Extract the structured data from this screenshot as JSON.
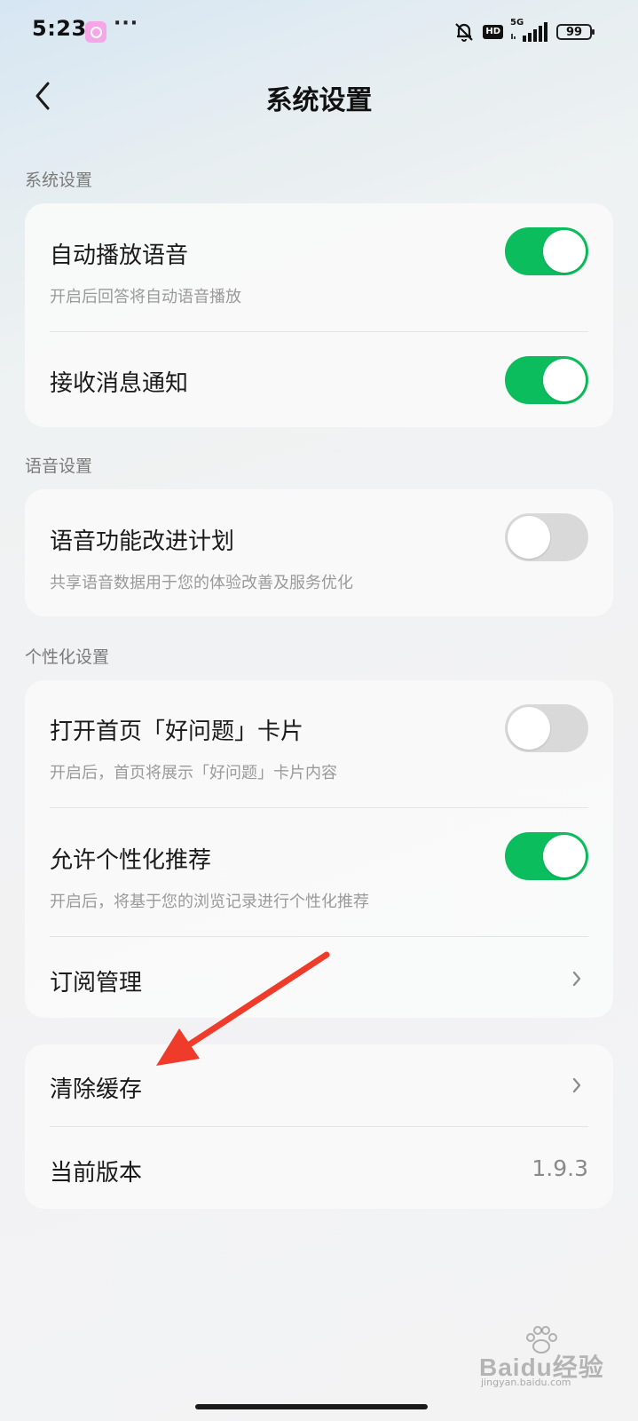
{
  "status_bar": {
    "time": "5:23",
    "more": "···",
    "hd": "HD",
    "network": "5G",
    "battery": "99"
  },
  "header": {
    "title": "系统设置"
  },
  "sections": {
    "system": {
      "label": "系统设置",
      "items": [
        {
          "title": "自动播放语音",
          "desc": "开启后回答将自动语音播放",
          "toggle": true
        },
        {
          "title": "接收消息通知",
          "toggle": true
        }
      ]
    },
    "voice": {
      "label": "语音设置",
      "items": [
        {
          "title": "语音功能改进计划",
          "desc": "共享语音数据用于您的体验改善及服务优化",
          "toggle": false
        }
      ]
    },
    "personal": {
      "label": "个性化设置",
      "items": [
        {
          "title": "打开首页「好问题」卡片",
          "desc": "开启后，首页将展示「好问题」卡片内容",
          "toggle": false
        },
        {
          "title": "允许个性化推荐",
          "desc": "开启后，将基于您的浏览记录进行个性化推荐",
          "toggle": true
        },
        {
          "title": "订阅管理"
        }
      ]
    },
    "other": {
      "items": [
        {
          "title": "清除缓存"
        },
        {
          "title": "当前版本",
          "value": "1.9.3"
        }
      ]
    }
  },
  "colors": {
    "toggle_on": "#0bbd5d",
    "toggle_off": "#d9d9d9",
    "annotation_arrow": "#ee3b2a"
  },
  "watermark": {
    "text": "Baidu经验",
    "sub": "jingyan.baidu.com"
  }
}
